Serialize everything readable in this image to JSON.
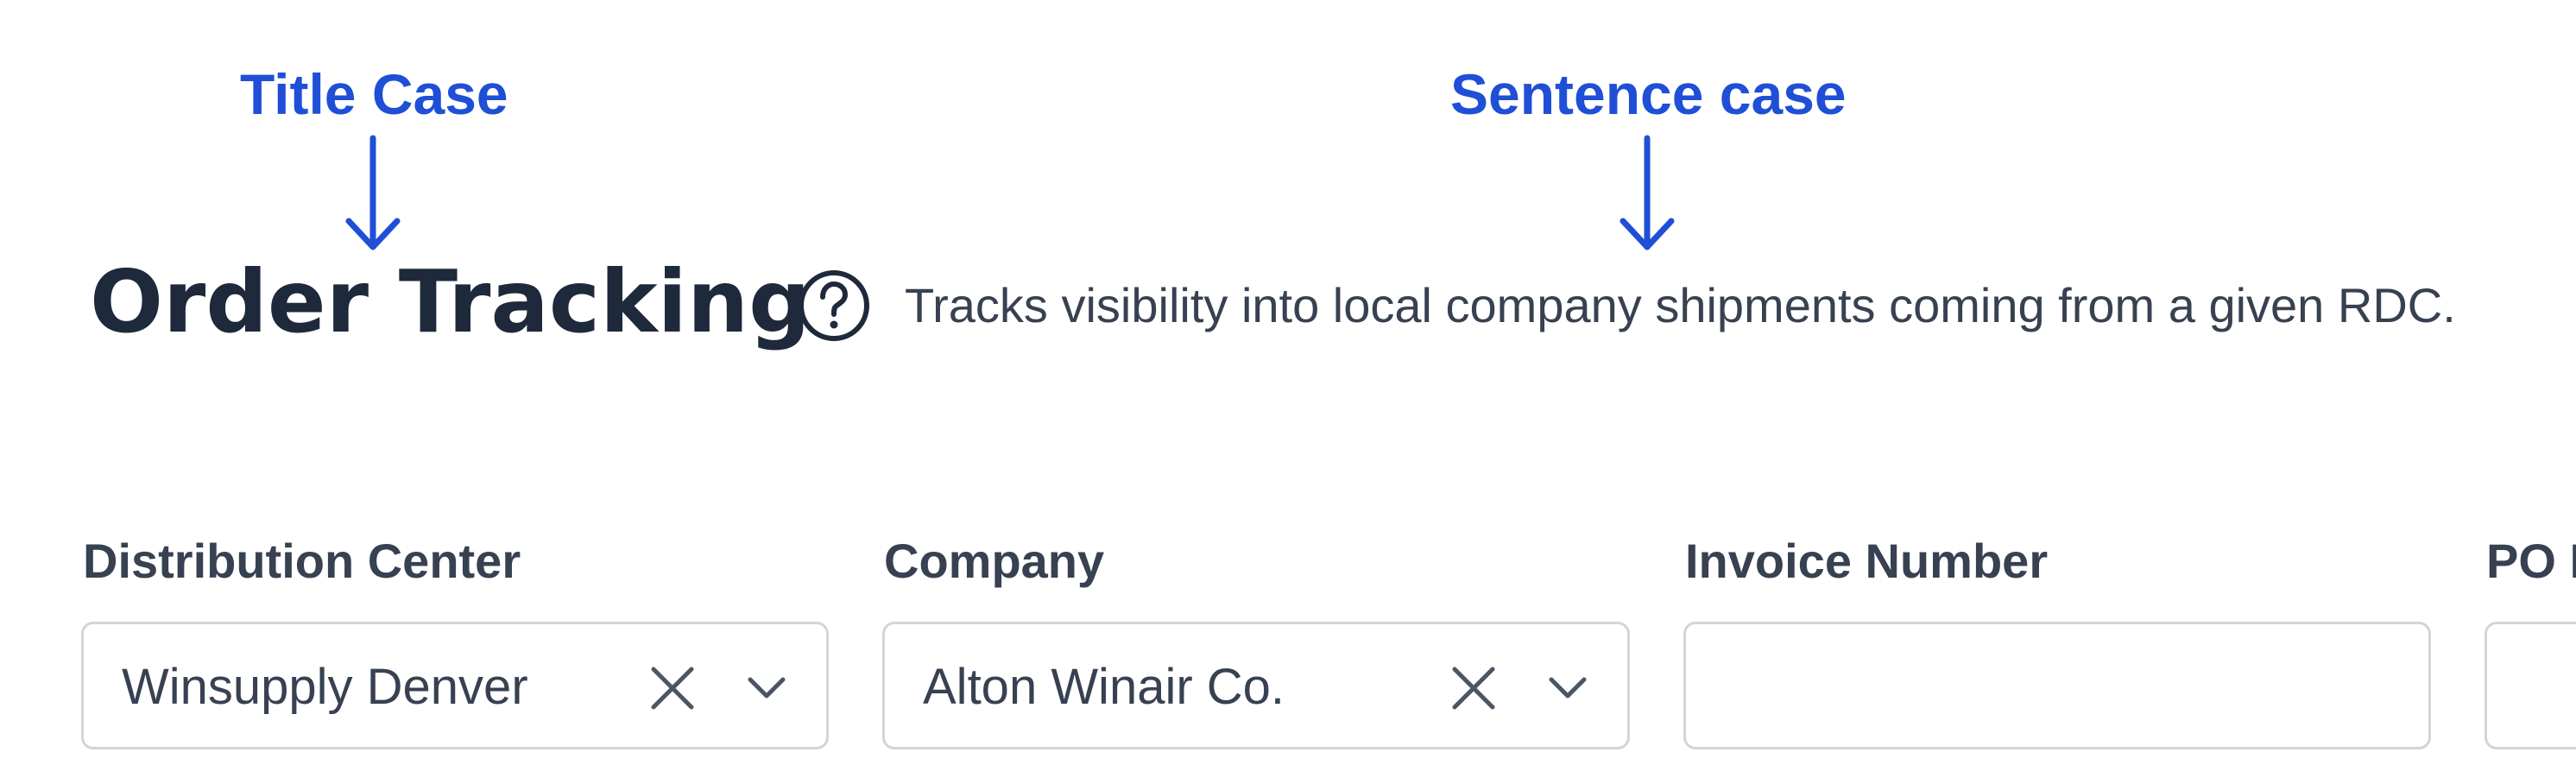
{
  "annotations": {
    "title_case": "Title Case",
    "sentence_case": "Sentence case"
  },
  "header": {
    "title": "Order Tracking",
    "description": "Tracks visibility into local company shipments coming from a given RDC.",
    "help_icon": "question-circle-icon"
  },
  "filters": [
    {
      "label": "Distribution Center",
      "value": "Winsupply Denver"
    },
    {
      "label": "Company",
      "value": "Alton Winair Co."
    },
    {
      "label": "Invoice Number",
      "value": ""
    },
    {
      "label": "PO Number",
      "value": ""
    }
  ],
  "colors": {
    "annotation": "#1f4fd6",
    "title": "#1e293b",
    "text": "#374151",
    "border": "#d1d5db"
  }
}
